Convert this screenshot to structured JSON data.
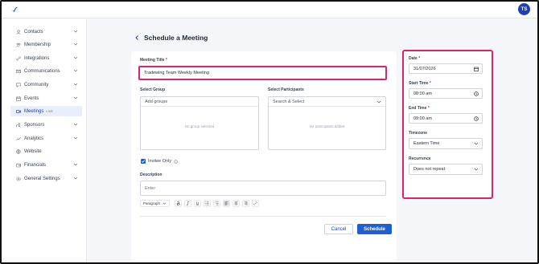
{
  "topbar": {
    "avatar_initials": "TS"
  },
  "sidebar": {
    "items": [
      {
        "label": "Contacts",
        "icon": "user-icon"
      },
      {
        "label": "Membership",
        "icon": "users-icon"
      },
      {
        "label": "Integrations",
        "icon": "link-icon"
      },
      {
        "label": "Communications",
        "icon": "mail-icon"
      },
      {
        "label": "Community",
        "icon": "chat-icon"
      },
      {
        "label": "Events",
        "icon": "calendar-icon"
      },
      {
        "label": "Meetings",
        "icon": "video-icon",
        "badge": "LIVE"
      },
      {
        "label": "Sponsors",
        "icon": "sponsor-icon"
      },
      {
        "label": "Analytics",
        "icon": "chart-icon"
      },
      {
        "label": "Website",
        "icon": "globe-icon"
      },
      {
        "label": "Financials",
        "icon": "wallet-icon"
      },
      {
        "label": "General Settings",
        "icon": "gear-icon"
      }
    ]
  },
  "page": {
    "title": "Schedule a Meeting"
  },
  "form": {
    "meeting_title_label": "Meeting Title",
    "meeting_title_value": "Tradewing Team Weekly Meeting",
    "select_group_label": "Select Group",
    "select_group_placeholder": "Add groups",
    "group_empty": "No group selected",
    "select_participants_label": "Select Participants",
    "select_participants_placeholder": "Search & Select",
    "participants_empty": "No participants added",
    "invitee_only_label": "Invitee Only",
    "description_label": "Description",
    "description_placeholder": "Enter",
    "paragraph_label": "Paragraph",
    "cancel_label": "Cancel",
    "schedule_label": "Schedule"
  },
  "side": {
    "date_label": "Date",
    "date_value": "31/07/2026",
    "start_label": "Start Time",
    "start_value": "08:00 am",
    "end_label": "End Time",
    "end_value": "09:00 am",
    "timezone_label": "Timezone",
    "timezone_value": "Eastern Time",
    "recurrence_label": "Recurrence",
    "recurrence_value": "Does not repeat"
  },
  "colors": {
    "accent": "#1f5fd6",
    "highlight": "#e0226a",
    "brand": "#1f3fb0"
  }
}
